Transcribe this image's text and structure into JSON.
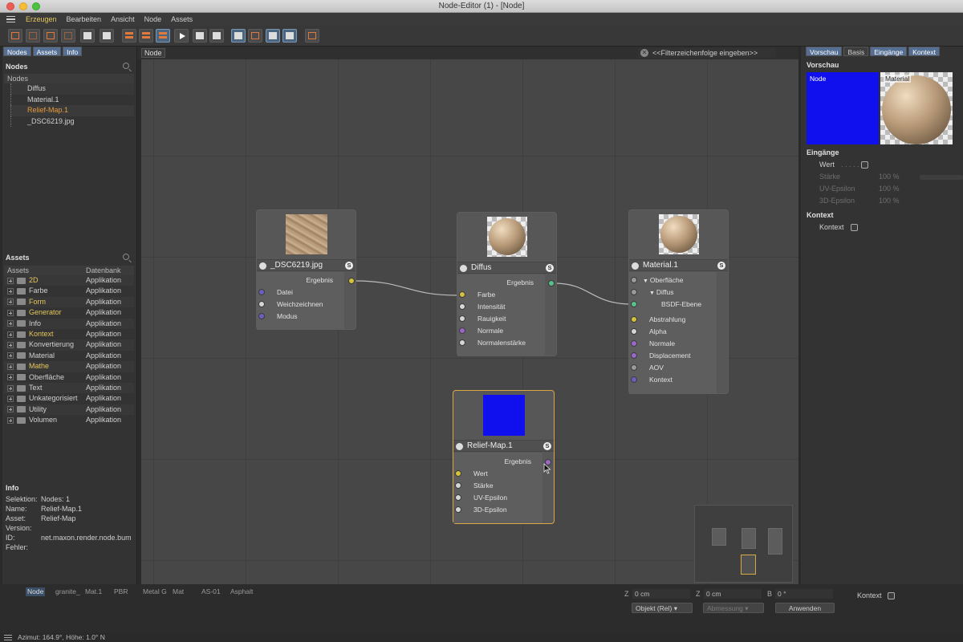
{
  "window": {
    "title": "Node-Editor (1) - [Node]"
  },
  "menu": [
    "Erzeugen",
    "Bearbeiten",
    "Ansicht",
    "Node",
    "Assets"
  ],
  "left": {
    "tabs": [
      "Nodes",
      "Assets",
      "Info"
    ],
    "nodes_heading": "Nodes",
    "nodes_tree_header": "Nodes",
    "nodes": [
      "Diffus",
      "Material.1",
      "Relief-Map.1",
      "_DSC6219.jpg"
    ],
    "assets_heading": "Assets",
    "assets_col_name": "Assets",
    "assets_col_db": "Datenbank",
    "assets": [
      {
        "name": "2D",
        "db": "Applikation",
        "hl": true
      },
      {
        "name": "Farbe",
        "db": "Applikation",
        "hl": false
      },
      {
        "name": "Form",
        "db": "Applikation",
        "hl": true
      },
      {
        "name": "Generator",
        "db": "Applikation",
        "hl": true
      },
      {
        "name": "Info",
        "db": "Applikation",
        "hl": false
      },
      {
        "name": "Kontext",
        "db": "Applikation",
        "hl": true
      },
      {
        "name": "Konvertierung",
        "db": "Applikation",
        "hl": false
      },
      {
        "name": "Material",
        "db": "Applikation",
        "hl": false
      },
      {
        "name": "Mathe",
        "db": "Applikation",
        "hl": true
      },
      {
        "name": "Oberfläche",
        "db": "Applikation",
        "hl": false
      },
      {
        "name": "Text",
        "db": "Applikation",
        "hl": false
      },
      {
        "name": "Unkategorisiert",
        "db": "Applikation",
        "hl": false
      },
      {
        "name": "Utility",
        "db": "Applikation",
        "hl": false
      },
      {
        "name": "Volumen",
        "db": "Applikation",
        "hl": false
      }
    ],
    "info_heading": "Info",
    "info": [
      {
        "k": "Selektion:",
        "v": "Nodes: 1"
      },
      {
        "k": "Name:",
        "v": "Relief-Map.1"
      },
      {
        "k": "Asset:",
        "v": "Relief-Map"
      },
      {
        "k": "Version:",
        "v": ""
      },
      {
        "k": "ID:",
        "v": "net.maxon.render.node.bump"
      },
      {
        "k": "Fehler:",
        "v": ""
      }
    ]
  },
  "canvas": {
    "breadcrumb": "Node",
    "filter_placeholder": "<<Filterzeichenfolge eingeben>>",
    "nodes": {
      "dsc": {
        "title": "_DSC6219.jpg",
        "output": "Ergebnis",
        "inputs": [
          "Datei",
          "Weichzeichnen",
          "Modus"
        ]
      },
      "diffus": {
        "title": "Diffus",
        "output": "Ergebnis",
        "inputs": [
          "Farbe",
          "Intensität",
          "Rauigkeit",
          "Normale",
          "Normalenstärke"
        ]
      },
      "material": {
        "title": "Material.1",
        "inputs": [
          "Oberfläche",
          "Diffus",
          "BSDF-Ebene",
          "Abstrahlung",
          "Alpha",
          "Normale",
          "Displacement",
          "AOV",
          "Kontext"
        ]
      },
      "relief": {
        "title": "Relief-Map.1",
        "output": "Ergebnis",
        "inputs": [
          "Wert",
          "Stärke",
          "UV-Epsilon",
          "3D-Epsilon"
        ]
      }
    },
    "badge": "S"
  },
  "right": {
    "tabs": [
      "Vorschau",
      "Basis",
      "Eingänge",
      "Kontext"
    ],
    "preview_heading": "Vorschau",
    "preview_node_label": "Node",
    "preview_material_label": "Material",
    "inputs_heading": "Eingänge",
    "inputs": [
      {
        "label": "Wert",
        "value": ""
      },
      {
        "label": "Stärke",
        "value": "100 %"
      },
      {
        "label": "UV-Epsilon",
        "value": "100 %"
      },
      {
        "label": "3D-Epsilon",
        "value": "100 %"
      }
    ],
    "context_heading": "Kontext",
    "context_label": "Kontext"
  },
  "bottom": {
    "tabs": [
      "Node",
      "granite_",
      "Mat.1",
      "PBR",
      "Metal G",
      "Mat",
      "AS-01",
      "Asphalt"
    ],
    "z1": "Z",
    "z1_val": "0 cm",
    "z2": "Z",
    "z2_val": "0 cm",
    "b": "B",
    "b_val": "0 °",
    "objekt": "Objekt (Rel)",
    "abmessung": "Abmessung",
    "anwenden": "Anwenden",
    "kontext": "Kontext"
  },
  "status": "Azimut: 164.9°, Höhe: 1.0°  N",
  "colors": {
    "accent_orange": "#e89a3c",
    "selection_blue": "#546e94",
    "preview_blue": "#1010ee"
  }
}
